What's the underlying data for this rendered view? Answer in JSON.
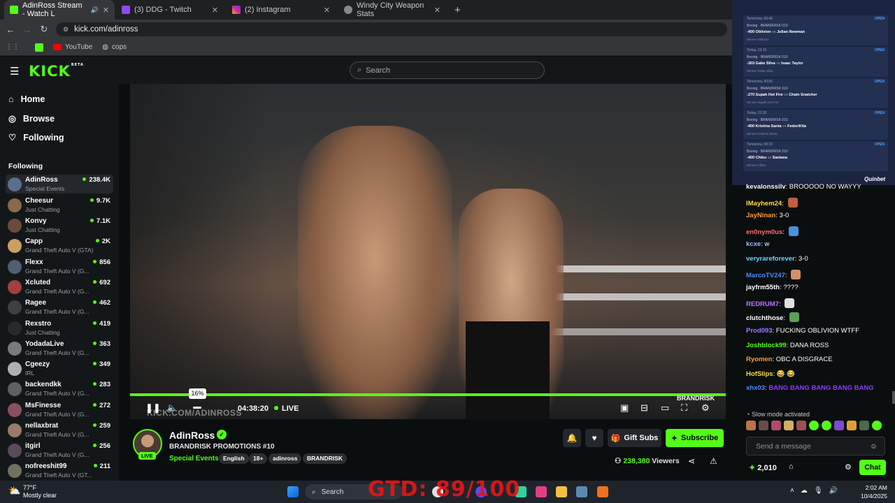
{
  "browser": {
    "tabs": [
      {
        "label": "AdinRoss Stream - Watch L",
        "active": true
      },
      {
        "label": "(3) DDG - Twitch",
        "active": false
      },
      {
        "label": "(2) Instagram",
        "active": false
      },
      {
        "label": "Windy City Weapon Stats",
        "active": false
      }
    ],
    "url": "kick.com/adinross",
    "bookmarks": [
      "YouTube",
      "cops"
    ]
  },
  "kick": {
    "logo": "KICK",
    "logo_badge": "BETA",
    "search_placeholder": "Search",
    "nav": [
      {
        "label": "Home",
        "icon": "home-icon"
      },
      {
        "label": "Browse",
        "icon": "compass-icon"
      },
      {
        "label": "Following",
        "icon": "heart-icon"
      }
    ],
    "following_title": "Following",
    "channels": [
      {
        "name": "AdinRoss",
        "category": "Special Events",
        "viewers": "238.4K",
        "selected": true,
        "color": "#5a6f8a"
      },
      {
        "name": "Cheesur",
        "category": "Just Chatting",
        "viewers": "9.7K",
        "color": "#8a6a4a"
      },
      {
        "name": "Konvy",
        "category": "Just Chatting",
        "viewers": "7.1K",
        "color": "#6a4a3a"
      },
      {
        "name": "Capp",
        "category": "Grand Theft Auto V (GTA)",
        "viewers": "2K",
        "color": "#c8a060"
      },
      {
        "name": "Flexx",
        "category": "Grand Theft Auto V (G...",
        "viewers": "856",
        "color": "#506070"
      },
      {
        "name": "Xcluted",
        "category": "Grand Theft Auto V (G...",
        "viewers": "692",
        "color": "#a04040"
      },
      {
        "name": "Ragee",
        "category": "Grand Theft Auto V (G...",
        "viewers": "462",
        "color": "#404040"
      },
      {
        "name": "Rexstro",
        "category": "Just Chatting",
        "viewers": "419",
        "color": "#2a2a2a"
      },
      {
        "name": "YodadaLive",
        "category": "Grand Theft Auto V (G...",
        "viewers": "363",
        "color": "#7a7a7a"
      },
      {
        "name": "Cgeezy",
        "category": "IRL",
        "viewers": "349",
        "color": "#b0b0b0"
      },
      {
        "name": "backendkk",
        "category": "Grand Theft Auto V (G...",
        "viewers": "283",
        "color": "#606060"
      },
      {
        "name": "MsFinesse",
        "category": "Grand Theft Auto V (G...",
        "viewers": "272",
        "color": "#8a5060"
      },
      {
        "name": "nellaxbrat",
        "category": "Grand Theft Auto V (G...",
        "viewers": "259",
        "color": "#9a7a6a"
      },
      {
        "name": "itgirl",
        "category": "Grand Theft Auto V (G...",
        "viewers": "256",
        "color": "#5a4a5a"
      },
      {
        "name": "nofreeshit99",
        "category": "Grand Theft Auto V (GT...",
        "viewers": "211",
        "color": "#707060"
      }
    ],
    "player": {
      "time": "04:38:20",
      "live_label": "LIVE",
      "volume_tooltip": "16%",
      "watermark": "KICK.COM/ADINROSS",
      "brand_watermark": "BRANDRISK"
    },
    "stream": {
      "streamer": "AdinRoss",
      "live_badge": "LIVE",
      "title": "BRANDRISK PROMOTIONS #10",
      "category": "Special Events",
      "tags": [
        "English",
        "18+",
        "adinross",
        "BRANDRISK"
      ],
      "gift_subs_label": "Gift Subs",
      "subscribe_label": "Subscribe",
      "viewers": "238,380",
      "viewers_label": "Viewers"
    },
    "bets": [
      {
        "when": "Tomorrow, 00:40",
        "league": "Boxing · BRANDRISK 010",
        "odds": "-400",
        "home": "Oblivion",
        "away": "Julian Newman",
        "winner": "Winner Oblivion",
        "status": "OPEN"
      },
      {
        "when": "Today, 23:15",
        "league": "Boxing · BRANDRISK 010",
        "odds": "-303",
        "home": "Gabe Silva",
        "away": "Isaac Taylor",
        "winner": "Winner Gabe Silva",
        "status": "OPEN"
      },
      {
        "when": "Tomorrow, 00:00",
        "league": "Boxing · BRANDRISK 010",
        "odds": "-270",
        "home": "Supah Hot Fire",
        "away": "Chain Snatcher",
        "winner": "Winner Supah Hot Fire",
        "status": "OPEN"
      },
      {
        "when": "Today, 21:20",
        "league": "Boxing · BRANDRISK 010",
        "odds": "-400",
        "home": "Kristina Santa",
        "away": "FederiKita",
        "winner": "Winner Kristina Santa",
        "status": "OPEN"
      },
      {
        "when": "Tomorrow, 00:15",
        "league": "Boxing · BRANDRISK 010",
        "odds": "-400",
        "home": "Chibu",
        "away": "Santana",
        "winner": "Winner Chibu",
        "status": "OPEN"
      }
    ],
    "bet_brand": "Quinbet",
    "chat": {
      "messages": [
        {
          "user": "kevalonssilv",
          "color": "#ffffff",
          "text": "BROOOOO NO WAYYY"
        },
        {
          "user": "IMayhem24",
          "color": "#ffd84a",
          "text": "",
          "emote": "#c06040"
        },
        {
          "user": "JayNinan",
          "color": "#ff9a3a",
          "text": "3-0"
        },
        {
          "user": "en0nym0us",
          "color": "#ff6b6b",
          "text": "",
          "emote": "#4a90e2"
        },
        {
          "user": "kcxe",
          "color": "#9ab8ff",
          "text": "w"
        },
        {
          "user": "veryrareforever",
          "color": "#6ad4ff",
          "text": "3-0"
        },
        {
          "user": "MarcoTV247",
          "color": "#4a8cff",
          "text": "",
          "emote": "#d0906a"
        },
        {
          "user": "jayfrm55th",
          "color": "#ffffff",
          "text": "????"
        },
        {
          "user": "REDRUM7",
          "color": "#c070ff",
          "text": "",
          "emote": "#e0e0e0"
        },
        {
          "user": "clutchthose",
          "color": "#ffffff",
          "text": "",
          "emote": "#5aa05a"
        },
        {
          "user": "Prod093",
          "color": "#9a7aff",
          "text": "FUCKING OBLIVION WTFF"
        },
        {
          "user": "Joshblock99",
          "color": "#53fc18",
          "text": "DANA ROSS"
        },
        {
          "user": "Ryomen",
          "color": "#ff9a3a",
          "text": "OBC A DISGRACE"
        },
        {
          "user": "HofSlips",
          "color": "#ffd84a",
          "text": "😂 😂"
        },
        {
          "user": "xhx03",
          "color": "#4a8cff",
          "text": "BANG BANG BANG BANG BANG"
        }
      ],
      "slow_mode": "Slow mode activated",
      "input_placeholder": "Send a message",
      "points": "2,010",
      "chat_button": "Chat"
    }
  },
  "taskbar": {
    "weather_temp": "77°F",
    "weather_desc": "Mostly clear",
    "search_label": "Search",
    "overlay_text": "GTD: 89/100",
    "time": "2:02 AM",
    "date": "10/4/2025"
  }
}
